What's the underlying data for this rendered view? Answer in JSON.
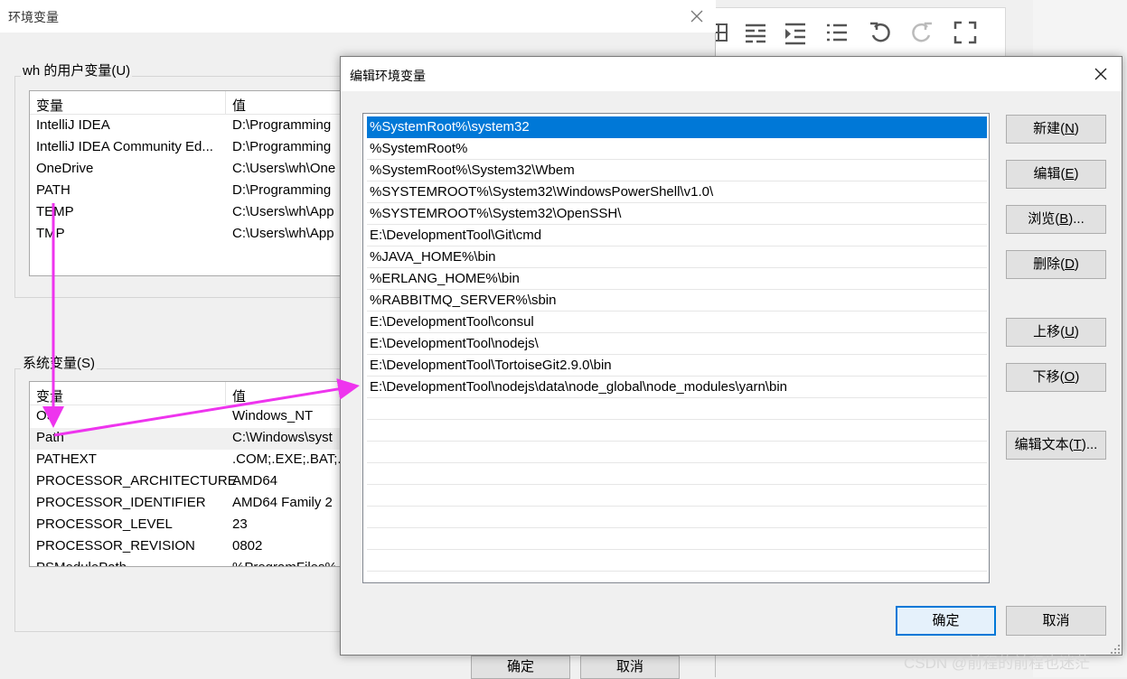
{
  "env_dialog": {
    "title": "环境变量",
    "user_group_label": "wh 的用户变量(U)",
    "system_group_label": "系统变量(S)",
    "columns": [
      "变量",
      "值"
    ],
    "user_vars": [
      {
        "name": "IntelliJ IDEA",
        "value": "D:\\Programming"
      },
      {
        "name": "IntelliJ IDEA Community Ed...",
        "value": "D:\\Programming"
      },
      {
        "name": "OneDrive",
        "value": "C:\\Users\\wh\\One"
      },
      {
        "name": "PATH",
        "value": "D:\\Programming"
      },
      {
        "name": "TEMP",
        "value": "C:\\Users\\wh\\App"
      },
      {
        "name": "TMP",
        "value": "C:\\Users\\wh\\App"
      }
    ],
    "system_vars": [
      {
        "name": "OS",
        "value": "Windows_NT"
      },
      {
        "name": "Path",
        "value": "C:\\Windows\\syst"
      },
      {
        "name": "PATHEXT",
        "value": ".COM;.EXE;.BAT;."
      },
      {
        "name": "PROCESSOR_ARCHITECTURE",
        "value": "AMD64"
      },
      {
        "name": "PROCESSOR_IDENTIFIER",
        "value": "AMD64 Family 2"
      },
      {
        "name": "PROCESSOR_LEVEL",
        "value": "23"
      },
      {
        "name": "PROCESSOR_REVISION",
        "value": "0802"
      },
      {
        "name": "PSModulePath",
        "value": "%ProgramFiles%"
      }
    ],
    "ok_label": "确定",
    "cancel_label": "取消"
  },
  "edit_dialog": {
    "title": "编辑环境变量",
    "paths": [
      "%SystemRoot%\\system32",
      "%SystemRoot%",
      "%SystemRoot%\\System32\\Wbem",
      "%SYSTEMROOT%\\System32\\WindowsPowerShell\\v1.0\\",
      "%SYSTEMROOT%\\System32\\OpenSSH\\",
      "E:\\DevelopmentTool\\Git\\cmd",
      "%JAVA_HOME%\\bin",
      "%ERLANG_HOME%\\bin",
      "%RABBITMQ_SERVER%\\sbin",
      "E:\\DevelopmentTool\\consul",
      "E:\\DevelopmentTool\\nodejs\\",
      "E:\\DevelopmentTool\\TortoiseGit2.9.0\\bin",
      "E:\\DevelopmentTool\\nodejs\\data\\node_global\\node_modules\\yarn\\bin"
    ],
    "selected_index": 0,
    "buttons": {
      "new": {
        "text": "新建(",
        "key": "N",
        "tail": ")"
      },
      "edit": {
        "text": "编辑(",
        "key": "E",
        "tail": ")"
      },
      "browse": {
        "text": "浏览(",
        "key": "B",
        "tail": ")..."
      },
      "delete": {
        "text": "删除(",
        "key": "D",
        "tail": ")"
      },
      "move_up": {
        "text": "上移(",
        "key": "U",
        "tail": ")"
      },
      "move_down": {
        "text": "下移(",
        "key": "O",
        "tail": ")"
      },
      "edit_text": {
        "text": "编辑文本(",
        "key": "T",
        "tail": ")..."
      }
    },
    "ok_label": "确定",
    "cancel_label": "取消"
  },
  "watermark": "CSDN @前程的前程也迷茫",
  "colors": {
    "selection": "#0078d7",
    "annotation_arrow": "#ee34ee"
  },
  "toolbar_icons": [
    "table-icon",
    "align-justify-icon",
    "indent-icon",
    "list-icon",
    "undo-icon",
    "redo-icon",
    "fullscreen-icon"
  ]
}
